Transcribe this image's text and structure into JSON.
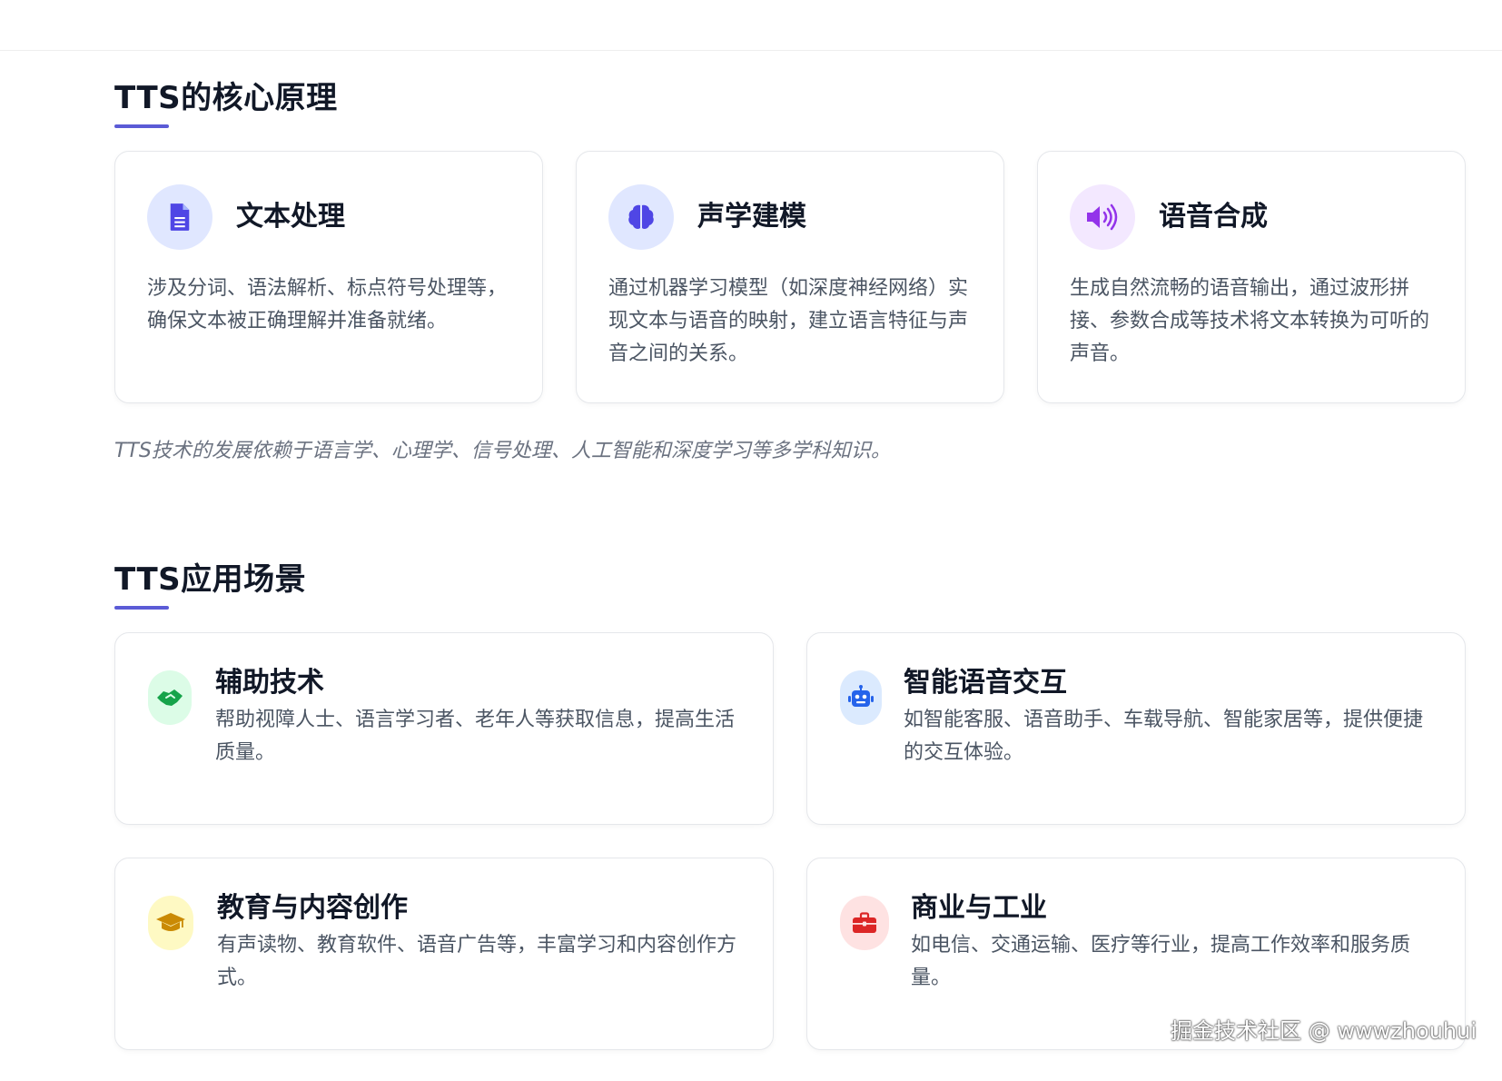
{
  "core_section": {
    "title": "TTS的核心原理",
    "cards": [
      {
        "icon": "document-icon",
        "title": "文本处理",
        "description": "涉及分词、语法解析、标点符号处理等，确保文本被正确理解并准备就绪。",
        "icon_color": "#4f46e5",
        "icon_bg": "#e0e7ff"
      },
      {
        "icon": "brain-icon",
        "title": "声学建模",
        "description": "通过机器学习模型（如深度神经网络）实现文本与语音的映射，建立语言特征与声音之间的关系。",
        "icon_color": "#4f46e5",
        "icon_bg": "#e0e7ff"
      },
      {
        "icon": "speaker-icon",
        "title": "语音合成",
        "description": "生成自然流畅的语音输出，通过波形拼接、参数合成等技术将文本转换为可听的声音。",
        "icon_color": "#9333ea",
        "icon_bg": "#f3e8ff"
      }
    ],
    "footnote": "TTS技术的发展依赖于语言学、心理学、信号处理、人工智能和深度学习等多学科知识。"
  },
  "app_section": {
    "title": "TTS应用场景",
    "cards": [
      {
        "icon": "handshake-icon",
        "title": "辅助技术",
        "description": "帮助视障人士、语言学习者、老年人等获取信息，提高生活质量。",
        "icon_color": "#16a34a",
        "icon_bg": "#dcfce7"
      },
      {
        "icon": "robot-icon",
        "title": "智能语音交互",
        "description": "如智能客服、语音助手、车载导航、智能家居等，提供便捷的交互体验。",
        "icon_color": "#2563eb",
        "icon_bg": "#dbeafe"
      },
      {
        "icon": "graduation-cap-icon",
        "title": "教育与内容创作",
        "description": "有声读物、教育软件、语音广告等，丰富学习和内容创作方式。",
        "icon_color": "#ca8a04",
        "icon_bg": "#fef9c3"
      },
      {
        "icon": "briefcase-icon",
        "title": "商业与工业",
        "description": "如电信、交通运输、医疗等行业，提高工作效率和服务质量。",
        "icon_color": "#dc2626",
        "icon_bg": "#fee2e2"
      }
    ]
  },
  "watermark": "掘金技术社区 @ wwwzhouhui",
  "accent_color": "#5b5bd6"
}
